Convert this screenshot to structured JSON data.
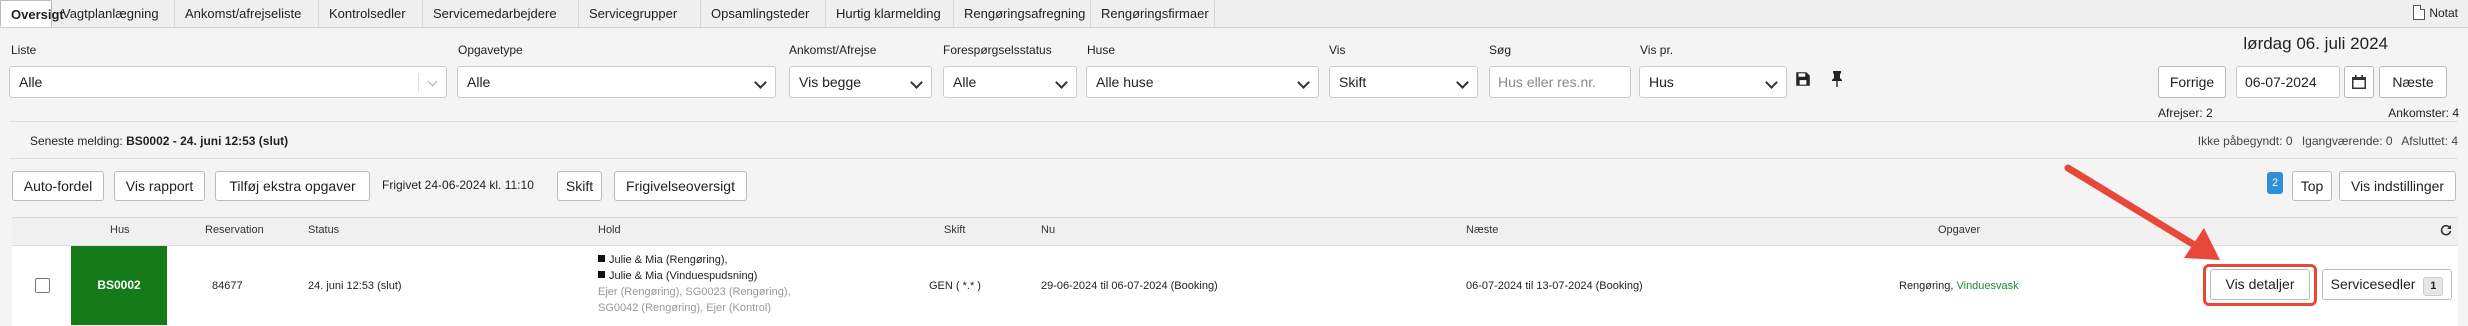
{
  "nav": {
    "tabs": [
      {
        "label": "Oversigt",
        "active": true
      },
      {
        "label": "Vagtplanlægning"
      },
      {
        "label": "Ankomst/afrejseliste"
      },
      {
        "label": "Kontrolsedler"
      },
      {
        "label": "Servicemedarbejdere"
      },
      {
        "label": "Servicegrupper"
      },
      {
        "label": "Opsamlingsteder"
      },
      {
        "label": "Hurtig klarmelding"
      },
      {
        "label": "Rengøringsafregning"
      },
      {
        "label": "Rengøringsfirmaer"
      }
    ],
    "notes_label": "Notat"
  },
  "filters": {
    "liste": {
      "label": "Liste",
      "value": "Alle"
    },
    "opgavetype": {
      "label": "Opgavetype",
      "value": "Alle"
    },
    "ankomst": {
      "label": "Ankomst/Afrejse",
      "value": "Vis begge"
    },
    "status": {
      "label": "Forespørgselsstatus",
      "value": "Alle"
    },
    "huse": {
      "label": "Huse",
      "value": "Alle huse"
    },
    "vis": {
      "label": "Vis",
      "value": "Skift"
    },
    "sog": {
      "label": "Søg",
      "placeholder": "Hus eller res.nr."
    },
    "vispr": {
      "label": "Vis pr.",
      "value": "Hus"
    }
  },
  "date_nav": {
    "date_heading": "lørdag 06. juli 2024",
    "prev_label": "Forrige",
    "date_value": "06-07-2024",
    "next_label": "Næste",
    "afrejser": "Afrejser: 2",
    "ankomster": "Ankomster: 4"
  },
  "message": {
    "prefix": "Seneste melding:",
    "text": "BS0002 - 24. juni 12:53 (slut)"
  },
  "status_counts": {
    "ikke_label": "Ikke påbegyndt:",
    "ikke_value": "0",
    "igang_label": "Igangværende:",
    "igang_value": "0",
    "afsl_label": "Afsluttet:",
    "afsl_value": "4"
  },
  "actions": {
    "auto_fordel": "Auto-fordel",
    "vis_rapport": "Vis rapport",
    "tilfoj": "Tilføj ekstra opgaver",
    "frigivet": "Frigivet 24-06-2024 kl. 11:10",
    "skift": "Skift",
    "frigivelse": "Frigivelseoversigt",
    "page_badge": "2",
    "top": "Top",
    "vis_indstillinger": "Vis indstillinger"
  },
  "table": {
    "headers": {
      "hus": "Hus",
      "reservation": "Reservation",
      "status": "Status",
      "hold": "Hold",
      "skift": "Skift",
      "nu": "Nu",
      "naeste": "Næste",
      "opgaver": "Opgaver"
    },
    "rows": [
      {
        "hus": "BS0002",
        "reservation": "84677",
        "status": "24. juni 12:53 (slut)",
        "hold_1": "Julie & Mia (Rengøring),",
        "hold_2": "Julie & Mia (Vinduespudsning)",
        "hold_3": "Ejer (Rengøring), SG0023 (Rengøring),",
        "hold_4": "SG0042 (Rengøring), Ejer (Kontrol)",
        "skift": "GEN ( *.* )",
        "nu": "29-06-2024 til 06-07-2024 (Booking)",
        "naeste": "06-07-2024 til 13-07-2024 (Booking)",
        "opgaver_1": "Rengøring,",
        "opgaver_2": "Vinduesvask",
        "vis_detaljer": "Vis detaljer",
        "servicesedler": "Servicesedler",
        "servicesedler_count": "1"
      }
    ]
  },
  "colors": {
    "accent_green": "#157a18",
    "link_green": "#1e8a2e",
    "annotation_red": "#e8483a",
    "badge_blue": "#2f8fd8"
  }
}
